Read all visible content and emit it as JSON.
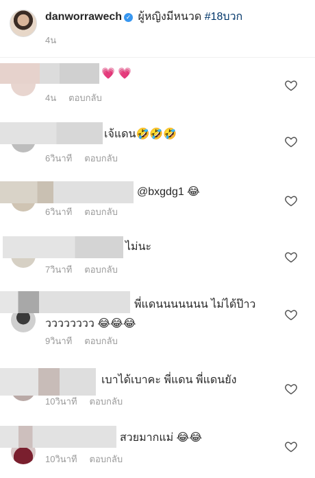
{
  "post": {
    "username": "danworrawech",
    "caption": "ผู้หญิงมีหนวด",
    "hashtag": "#18บวก",
    "time": "4น"
  },
  "reply_label": "ตอบกลับ",
  "comments": [
    {
      "text": "💗 💗",
      "time": "4น"
    },
    {
      "text": "เจ้แดน🤣🤣🤣",
      "time": "6วินาที"
    },
    {
      "text": "@bxgdg1 😂",
      "time": "6วินาที"
    },
    {
      "text": "ไม่นะ",
      "time": "7วินาที"
    },
    {
      "text": "พี่แดนนนนนนน ไม่ได้ป๊าววววววววว 😂😂😂",
      "time": "9วินาที"
    },
    {
      "text": "เบาได้เบาคะ พี่แดน พี่แดนยัง",
      "time": "10วินาที"
    },
    {
      "text": "สวยมากแม่ 😂😂",
      "time": "10วินาที"
    }
  ],
  "icons": {
    "heart": "heart-outline-icon",
    "verified": "verified-badge-icon"
  },
  "colors": {
    "link": "#003569",
    "verified": "#3897f0",
    "meta": "#999999",
    "text": "#262626"
  }
}
